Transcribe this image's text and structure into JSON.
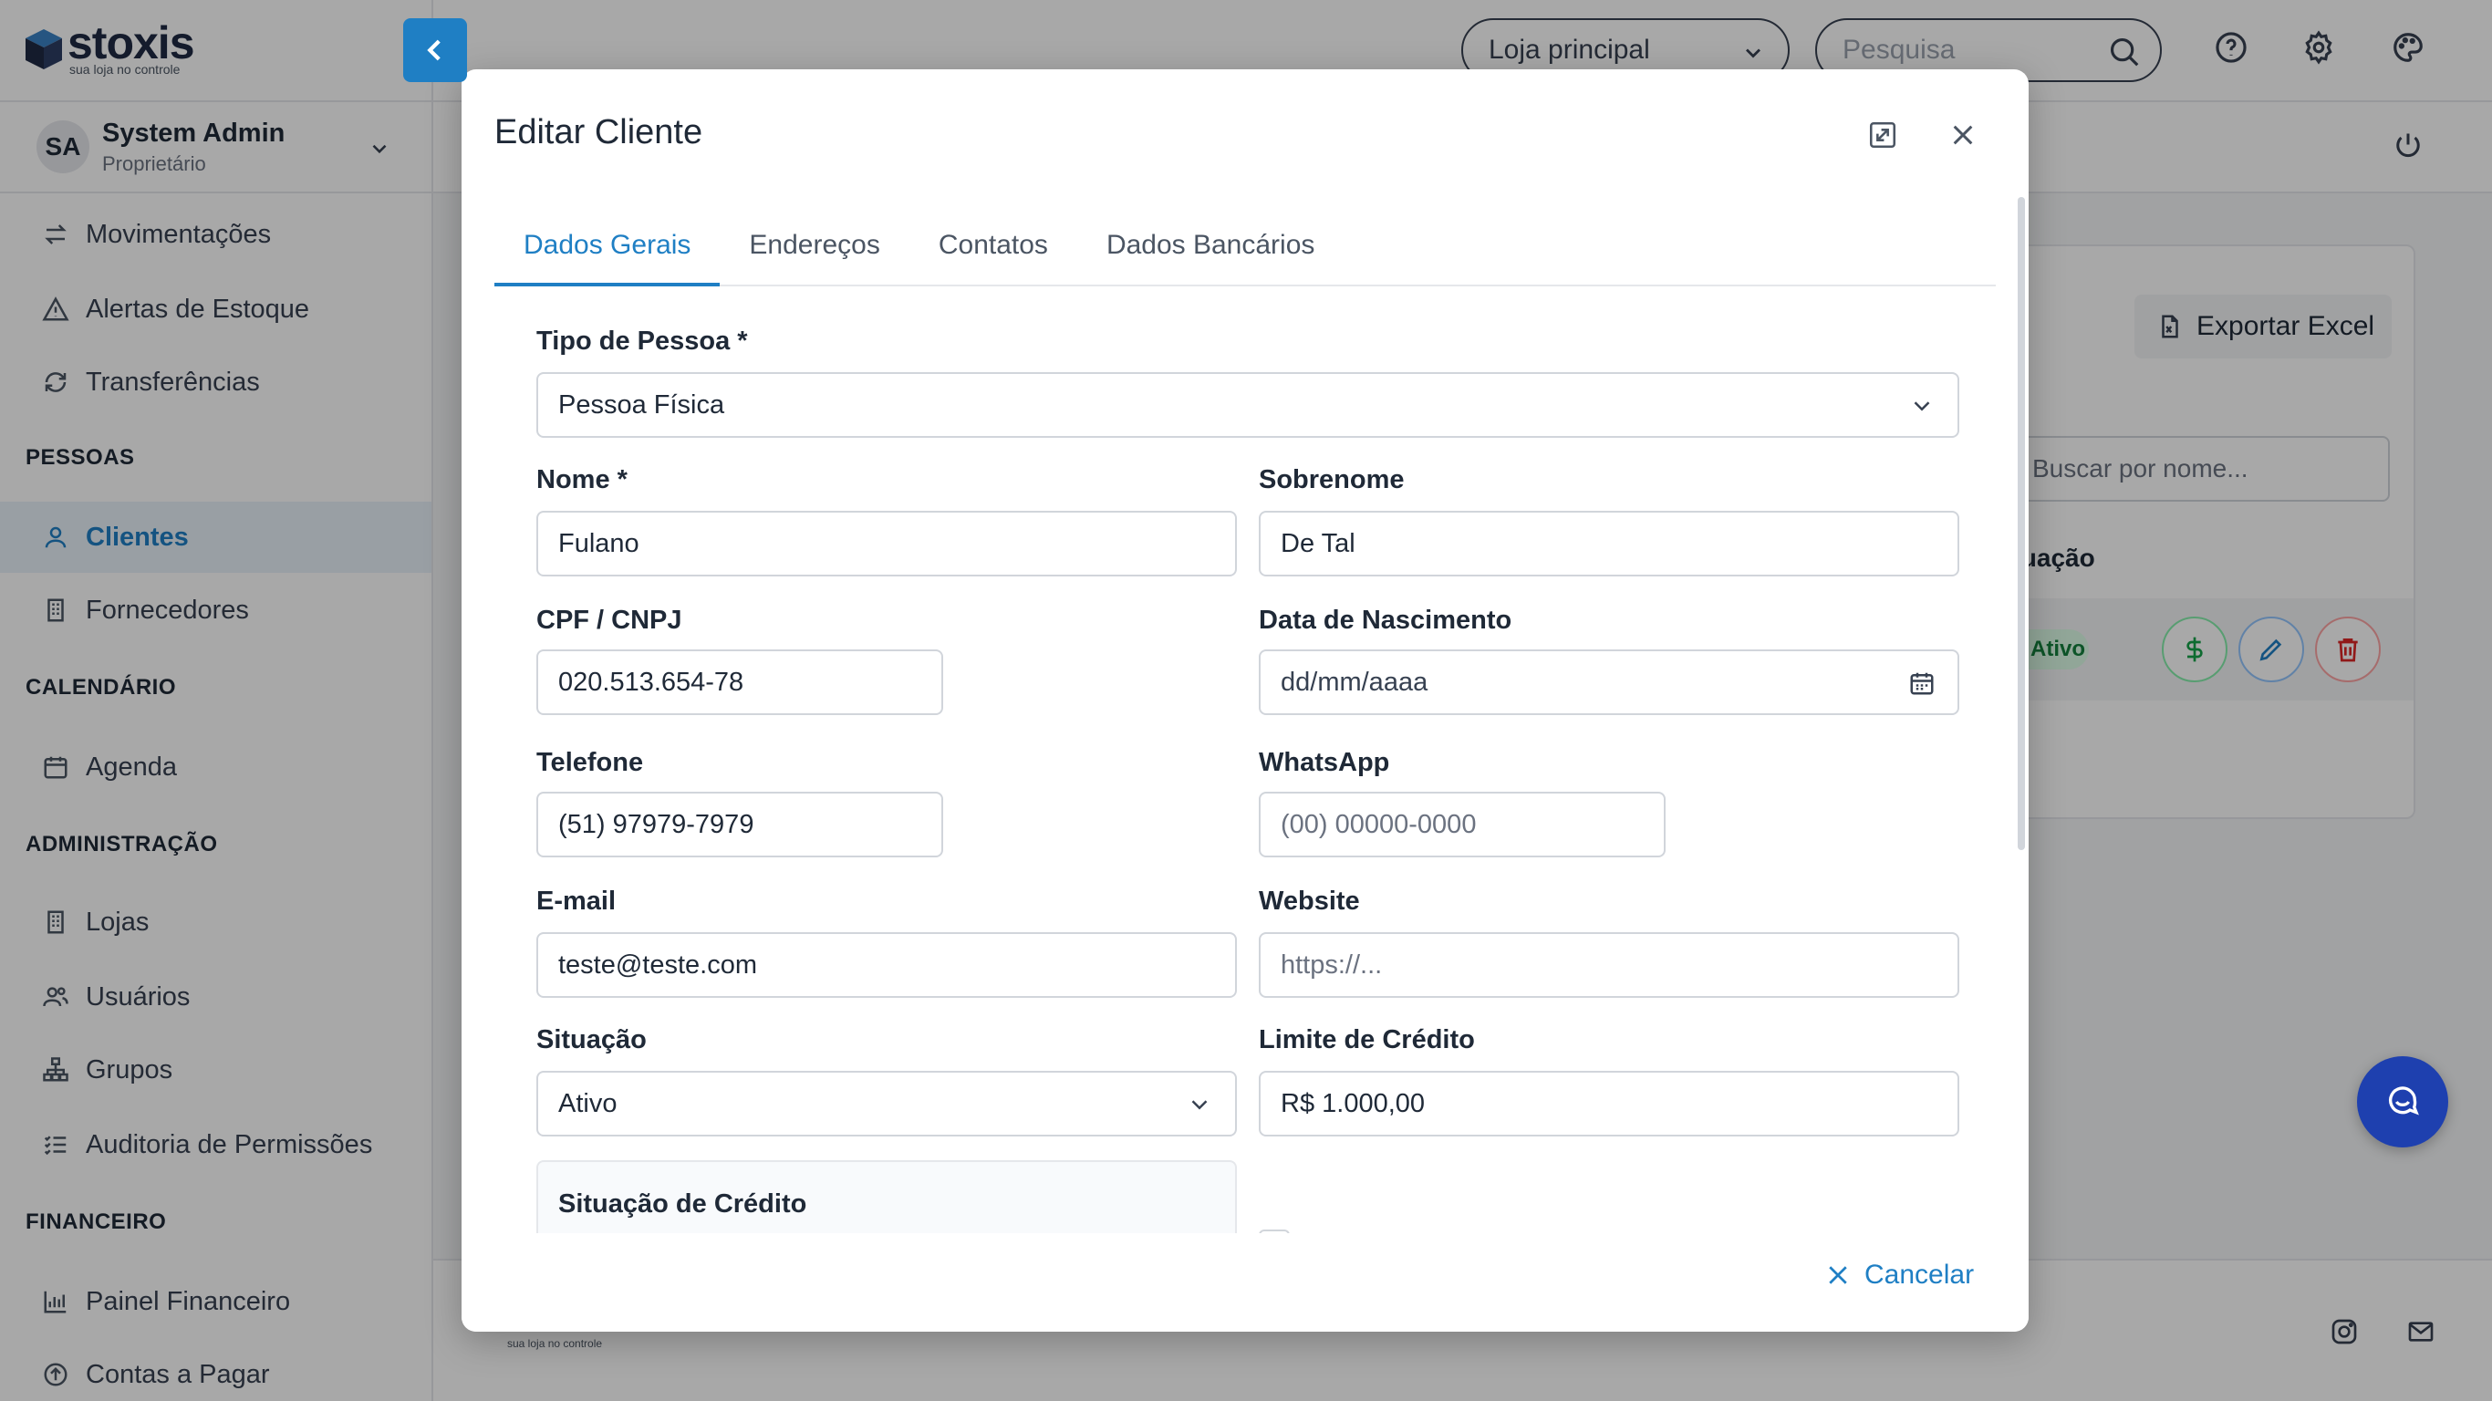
{
  "app": {
    "logo_text": "stoxis",
    "logo_tagline": "sua loja no controle",
    "user": {
      "initials": "SA",
      "name": "System Admin",
      "role": "Proprietário"
    },
    "nav": {
      "movimentacoes": "Movimentações",
      "alertas": "Alertas de Estoque",
      "transferencias": "Transferências",
      "section_pessoas": "PESSOAS",
      "clientes": "Clientes",
      "fornecedores": "Fornecedores",
      "section_calendario": "CALENDÁRIO",
      "agenda": "Agenda",
      "section_admin": "ADMINISTRAÇÃO",
      "lojas": "Lojas",
      "usuarios": "Usuários",
      "grupos": "Grupos",
      "auditoria": "Auditoria de Permissões",
      "section_financeiro": "FINANCEIRO",
      "painel": "Painel Financeiro",
      "contas_pagar": "Contas a Pagar"
    },
    "topbar": {
      "store_selected": "Loja principal",
      "search_placeholder": "Pesquisa"
    },
    "content": {
      "export_label": "Exportar Excel",
      "search_placeholder": "Buscar por nome...",
      "col_situacao": "Situação",
      "status_badge": "Ativo"
    },
    "accent_color": "#1f7fc4"
  },
  "modal": {
    "title": "Editar Cliente",
    "tabs": [
      "Dados Gerais",
      "Endereços",
      "Contatos",
      "Dados Bancários"
    ],
    "active_tab": "Dados Gerais",
    "fields": {
      "tipo_pessoa": {
        "label": "Tipo de Pessoa *",
        "value": "Pessoa Física"
      },
      "nome": {
        "label": "Nome *",
        "value": "Fulano"
      },
      "sobrenome": {
        "label": "Sobrenome",
        "value": "De Tal"
      },
      "cpf": {
        "label": "CPF / CNPJ",
        "value": "020.513.654-78"
      },
      "nascimento": {
        "label": "Data de Nascimento",
        "placeholder": "dd/mm/aaaa"
      },
      "telefone": {
        "label": "Telefone",
        "value": "(51) 97979-7979"
      },
      "whatsapp": {
        "label": "WhatsApp",
        "placeholder": "(00) 00000-0000"
      },
      "email": {
        "label": "E-mail",
        "value": "teste@teste.com"
      },
      "website": {
        "label": "Website",
        "placeholder": "https://..."
      },
      "situacao": {
        "label": "Situação",
        "value": "Ativo"
      },
      "limite": {
        "label": "Limite de Crédito",
        "value": "R$ 1.000,00"
      }
    },
    "credit_section_title": "Situação de Crédito",
    "cancel_label": "Cancelar"
  }
}
